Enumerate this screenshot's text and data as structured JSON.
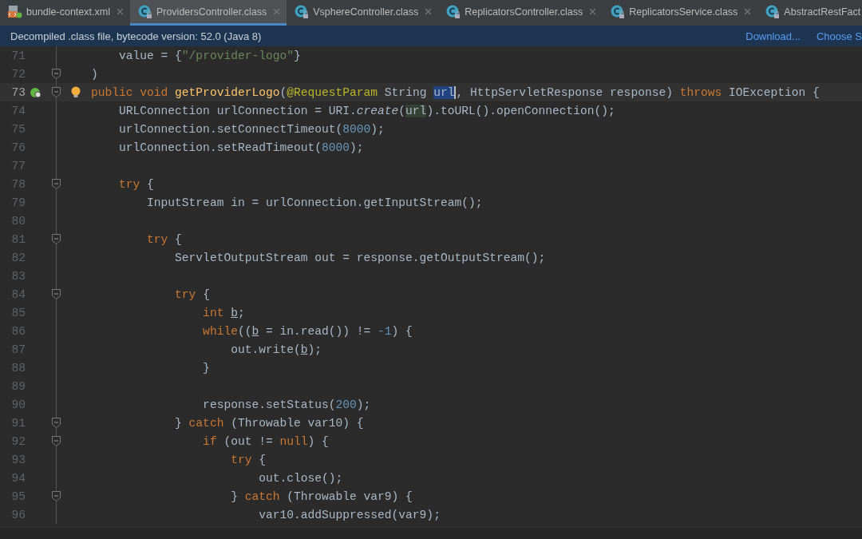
{
  "tabs": [
    {
      "label": "bundle-context.xml",
      "kind": "xml",
      "selected": false,
      "closable": true
    },
    {
      "label": "ProvidersController.class",
      "kind": "class",
      "selected": true,
      "closable": true
    },
    {
      "label": "VsphereController.class",
      "kind": "class",
      "selected": false,
      "closable": true
    },
    {
      "label": "ReplicatorsController.class",
      "kind": "class",
      "selected": false,
      "closable": true
    },
    {
      "label": "ReplicatorsService.class",
      "kind": "class",
      "selected": false,
      "closable": true
    },
    {
      "label": "AbstractRestFact",
      "kind": "class",
      "selected": false,
      "closable": false
    }
  ],
  "info_bar": {
    "message": "Decompiled .class file, bytecode version: 52.0 (Java 8)",
    "links": [
      "Download...",
      "Choose S"
    ]
  },
  "editor": {
    "lines": [
      {
        "number": "71",
        "current": false,
        "fold": false,
        "segments": [
          {
            "kind": "plain",
            "t": "    value = {"
          },
          {
            "kind": "str",
            "t": "\"/provider-logo\""
          },
          {
            "kind": "plain",
            "t": "}"
          }
        ]
      },
      {
        "number": "72",
        "current": false,
        "fold": true,
        "segments": [
          {
            "kind": "plain",
            "t": ")"
          }
        ]
      },
      {
        "number": "73",
        "current": true,
        "fold": true,
        "markers": [
          {
            "kind": "endpoint"
          },
          {
            "kind": "bulb"
          }
        ],
        "segments": [
          {
            "kind": "kw",
            "t": "public void "
          },
          {
            "kind": "fn",
            "t": "getProviderLogo"
          },
          {
            "kind": "plain",
            "t": "("
          },
          {
            "kind": "ann",
            "t": "@RequestParam"
          },
          {
            "kind": "plain",
            "t": " String "
          },
          {
            "kind": "hl-write",
            "t": "url"
          },
          {
            "kind": "plain",
            "t": ", HttpServletResponse response) "
          },
          {
            "kind": "kw",
            "t": "throws"
          },
          {
            "kind": "plain",
            "t": " IOException {"
          }
        ]
      },
      {
        "number": "74",
        "current": false,
        "fold": false,
        "segments": [
          {
            "kind": "plain",
            "t": "    URLConnection urlConnection = URI."
          },
          {
            "kind": "italic",
            "t": "create"
          },
          {
            "kind": "plain",
            "t": "("
          },
          {
            "kind": "hl-read",
            "t": "url"
          },
          {
            "kind": "plain",
            "t": ").toURL().openConnection();"
          }
        ]
      },
      {
        "number": "75",
        "current": false,
        "fold": false,
        "segments": [
          {
            "kind": "plain",
            "t": "    urlConnection.setConnectTimeout("
          },
          {
            "kind": "num",
            "t": "8000"
          },
          {
            "kind": "plain",
            "t": ");"
          }
        ]
      },
      {
        "number": "76",
        "current": false,
        "fold": false,
        "segments": [
          {
            "kind": "plain",
            "t": "    urlConnection.setReadTimeout("
          },
          {
            "kind": "num",
            "t": "8000"
          },
          {
            "kind": "plain",
            "t": ");"
          }
        ]
      },
      {
        "number": "77",
        "current": false,
        "fold": false
      },
      {
        "number": "78",
        "current": false,
        "fold": true,
        "segments": [
          {
            "kind": "kw",
            "t": "    try"
          },
          {
            "kind": "plain",
            "t": " {"
          }
        ]
      },
      {
        "number": "79",
        "current": false,
        "fold": false,
        "segments": [
          {
            "kind": "plain",
            "t": "        InputStream in = urlConnection.getInputStream();"
          }
        ]
      },
      {
        "number": "80",
        "current": false,
        "fold": false
      },
      {
        "number": "81",
        "current": false,
        "fold": true,
        "segments": [
          {
            "kind": "kw",
            "t": "        try"
          },
          {
            "kind": "plain",
            "t": " {"
          }
        ]
      },
      {
        "number": "82",
        "current": false,
        "fold": false,
        "segments": [
          {
            "kind": "plain",
            "t": "            ServletOutputStream out = response.getOutputStream();"
          }
        ]
      },
      {
        "number": "83",
        "current": false,
        "fold": false
      },
      {
        "number": "84",
        "current": false,
        "fold": true,
        "segments": [
          {
            "kind": "kw",
            "t": "            try"
          },
          {
            "kind": "plain",
            "t": " {"
          }
        ]
      },
      {
        "number": "85",
        "current": false,
        "fold": false,
        "segments": [
          {
            "kind": "kw",
            "t": "                int "
          },
          {
            "kind": "reassigned",
            "t": "b"
          },
          {
            "kind": "plain",
            "t": ";"
          }
        ]
      },
      {
        "number": "86",
        "current": false,
        "fold": false,
        "segments": [
          {
            "kind": "kw",
            "t": "                while"
          },
          {
            "kind": "plain",
            "t": "(("
          },
          {
            "kind": "reassigned",
            "t": "b"
          },
          {
            "kind": "plain",
            "t": " = in.read()) != "
          },
          {
            "kind": "num",
            "t": "-1"
          },
          {
            "kind": "plain",
            "t": ") {"
          }
        ]
      },
      {
        "number": "87",
        "current": false,
        "fold": false,
        "segments": [
          {
            "kind": "plain",
            "t": "                    out.write("
          },
          {
            "kind": "reassigned",
            "t": "b"
          },
          {
            "kind": "plain",
            "t": ");"
          }
        ]
      },
      {
        "number": "88",
        "current": false,
        "fold": false,
        "segments": [
          {
            "kind": "plain",
            "t": "                }"
          }
        ]
      },
      {
        "number": "89",
        "current": false,
        "fold": false
      },
      {
        "number": "90",
        "current": false,
        "fold": false,
        "segments": [
          {
            "kind": "plain",
            "t": "                response.setStatus("
          },
          {
            "kind": "num",
            "t": "200"
          },
          {
            "kind": "plain",
            "t": ");"
          }
        ]
      },
      {
        "number": "91",
        "current": false,
        "fold": true,
        "segments": [
          {
            "kind": "plain",
            "t": "            } "
          },
          {
            "kind": "kw",
            "t": "catch"
          },
          {
            "kind": "plain",
            "t": " (Throwable var10) {"
          }
        ]
      },
      {
        "number": "92",
        "current": false,
        "fold": true,
        "segments": [
          {
            "kind": "kw",
            "t": "                if"
          },
          {
            "kind": "plain",
            "t": " (out != "
          },
          {
            "kind": "kw",
            "t": "null"
          },
          {
            "kind": "plain",
            "t": ") {"
          }
        ]
      },
      {
        "number": "93",
        "current": false,
        "fold": false,
        "segments": [
          {
            "kind": "kw",
            "t": "                    try"
          },
          {
            "kind": "plain",
            "t": " {"
          }
        ]
      },
      {
        "number": "94",
        "current": false,
        "fold": false,
        "segments": [
          {
            "kind": "plain",
            "t": "                        out.close();"
          }
        ]
      },
      {
        "number": "95",
        "current": false,
        "fold": true,
        "segments": [
          {
            "kind": "plain",
            "t": "                    } "
          },
          {
            "kind": "kw",
            "t": "catch"
          },
          {
            "kind": "plain",
            "t": " (Throwable var9) {"
          }
        ]
      },
      {
        "number": "96",
        "current": false,
        "fold": false,
        "segments": [
          {
            "kind": "plain",
            "t": "                        var10.addSuppressed(var9);"
          }
        ]
      }
    ]
  }
}
